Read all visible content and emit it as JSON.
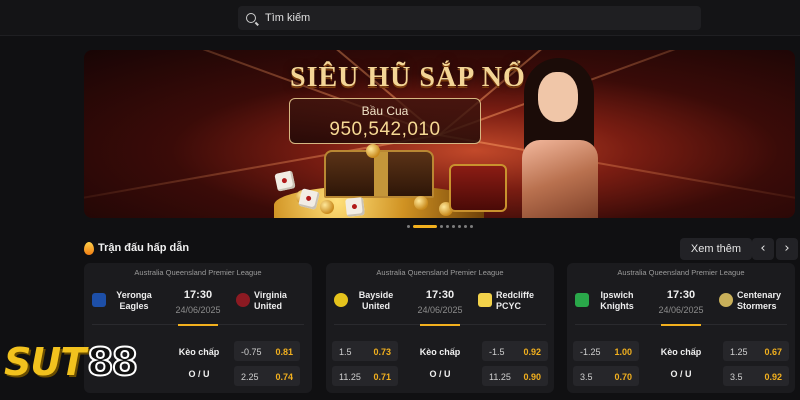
{
  "search": {
    "placeholder": "Tìm kiếm"
  },
  "banner": {
    "title": "SIÊU HŨ SẮP NỔ",
    "jackpot_game": "Bầu Cua",
    "jackpot_amount": "950,542,010",
    "slide_count": 8,
    "active_slide": 1
  },
  "section": {
    "title": "Trận đấu hấp dẫn",
    "see_more": "Xem thêm",
    "prev": "‹",
    "next": "›"
  },
  "matches": [
    {
      "league": "Australia Queensland Premier League",
      "home": "Yeronga Eagles",
      "away": "Virginia United",
      "time": "17:30",
      "date": "24/06/2025",
      "handicap": {
        "label": "Kèo chấp",
        "home_line": "",
        "home_odds": "",
        "away_line": "-0.75",
        "away_odds": "0.81"
      },
      "over_under": {
        "label": "O / U",
        "over_line": "2.25",
        "over_odds": "",
        "under_line": "2.25",
        "under_odds": "0.74"
      }
    },
    {
      "league": "Australia Queensland Premier League",
      "home": "Bayside United",
      "away": "Redcliffe PCYC",
      "time": "17:30",
      "date": "24/06/2025",
      "handicap": {
        "label": "Kèo chấp",
        "home_line": "1.5",
        "home_odds": "0.73",
        "away_line": "-1.5",
        "away_odds": "0.92"
      },
      "over_under": {
        "label": "O / U",
        "over_line": "11.25",
        "over_odds": "0.71",
        "under_line": "11.25",
        "under_odds": "0.90"
      }
    },
    {
      "league": "Australia Queensland Premier League",
      "home": "Ipswich Knights",
      "away": "Centenary Stormers",
      "time": "17:30",
      "date": "24/06/2025",
      "handicap": {
        "label": "Kèo chấp",
        "home_line": "-1.25",
        "home_odds": "1.00",
        "away_line": "1.25",
        "away_odds": "0.67"
      },
      "over_under": {
        "label": "O / U",
        "over_line": "3.5",
        "over_odds": "0.70",
        "under_line": "3.5",
        "under_odds": "0.92"
      }
    }
  ],
  "brand": {
    "logo_text_left": "SUT",
    "logo_text_right": "88",
    "accent": "#f2b01e"
  }
}
